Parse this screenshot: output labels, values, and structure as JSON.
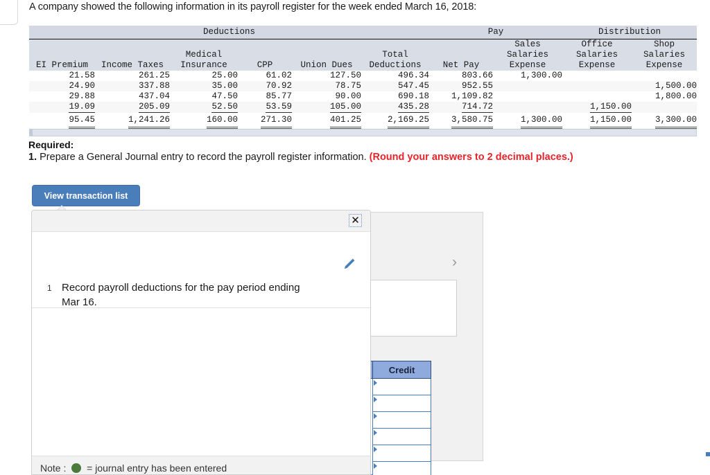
{
  "intro": {
    "text": "A company showed the following information in its payroll register for the week ended March 16, 2018:"
  },
  "payroll_table": {
    "group_headers": [
      {
        "label": "Deductions",
        "span": 6
      },
      {
        "label": "Pay",
        "span": 2
      },
      {
        "label": "Distribution",
        "span": 3
      }
    ],
    "columns": [
      {
        "lines": [
          "EI Premium"
        ]
      },
      {
        "lines": [
          "Income Taxes"
        ]
      },
      {
        "lines": [
          "Medical",
          "Insurance"
        ]
      },
      {
        "lines": [
          "CPP"
        ]
      },
      {
        "lines": [
          "Union Dues"
        ]
      },
      {
        "lines": [
          "Total",
          "Deductions"
        ]
      },
      {
        "lines": [
          "Net Pay"
        ]
      },
      {
        "lines": [
          "Sales",
          "Salaries",
          "Expense"
        ]
      },
      {
        "lines": [
          "Office",
          "Salaries",
          "Expense"
        ]
      },
      {
        "lines": [
          "Shop Salaries",
          "Expense"
        ]
      }
    ],
    "rows": [
      [
        "21.58",
        "261.25",
        "25.00",
        "61.02",
        "127.50",
        "496.34",
        "803.66",
        "1,300.00",
        "",
        ""
      ],
      [
        "24.90",
        "337.88",
        "35.00",
        "70.92",
        "78.75",
        "547.45",
        "952.55",
        "",
        "",
        "1,500.00"
      ],
      [
        "29.88",
        "437.04",
        "47.50",
        "85.77",
        "90.00",
        "690.18",
        "1,109.82",
        "",
        "",
        "1,800.00"
      ],
      [
        "19.09",
        "205.09",
        "52.50",
        "53.59",
        "105.00",
        "435.28",
        "714.72",
        "",
        "1,150.00",
        ""
      ]
    ],
    "totals": [
      "95.45",
      "1,241.26",
      "160.00",
      "271.30",
      "401.25",
      "2,169.25",
      "3,580.75",
      "1,300.00",
      "1,150.00",
      "3,300.00"
    ]
  },
  "required": {
    "label": "Required:",
    "number": "1.",
    "text": "Prepare a General Journal entry to record the payroll register information.",
    "note": "(Round your answers to 2 decimal places.)",
    "note_color": "#e8232a"
  },
  "toolbar": {
    "view_transaction_list": "View transaction list"
  },
  "modal": {
    "close_label": "✕",
    "transactions": [
      {
        "number": "1",
        "text": "Record payroll deductions for the pay period ending Mar 16."
      }
    ],
    "footer_note_prefix": "Note :",
    "footer_note_suffix": "= journal entry has been entered",
    "footer_dot_color": "#4a7a3c"
  },
  "journal": {
    "next_chevron": "›",
    "credit_header": "Credit",
    "credit_rows": [
      "",
      "",
      "",
      "",
      "",
      ""
    ]
  },
  "colors": {
    "accent_blue": "#4a7ebb",
    "header_blue": "#8faadc",
    "table_header_bg": "#d9dde6",
    "group_header_bg": "#d3d8e3"
  }
}
